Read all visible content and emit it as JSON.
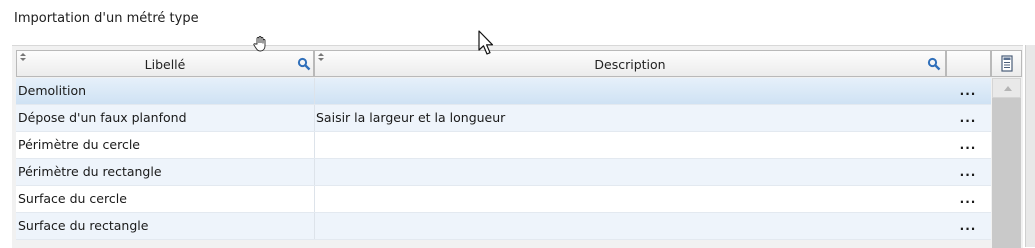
{
  "title": "Importation d'un métré type",
  "columns": {
    "libelle": "Libellé",
    "description": "Description"
  },
  "rows": [
    {
      "libelle": "Demolition",
      "description": "",
      "action": "..."
    },
    {
      "libelle": "Dépose d'un faux planfond",
      "description": "Saisir la largeur et la longueur",
      "action": "..."
    },
    {
      "libelle": "Périmètre du cercle",
      "description": "",
      "action": "..."
    },
    {
      "libelle": "Périmètre du rectangle",
      "description": "",
      "action": "..."
    },
    {
      "libelle": "Surface du cercle",
      "description": "",
      "action": "..."
    },
    {
      "libelle": "Surface du rectangle",
      "description": "",
      "action": "..."
    }
  ],
  "colors": {
    "accent": "#2f6fba",
    "selected_row": "#d3e4f5",
    "alt_row": "#eef4fb"
  },
  "icons": [
    "sort-arrows-icon",
    "search-icon",
    "column-chooser-icon",
    "scroll-up-icon",
    "hand-cursor-icon",
    "arrow-cursor-icon"
  ]
}
